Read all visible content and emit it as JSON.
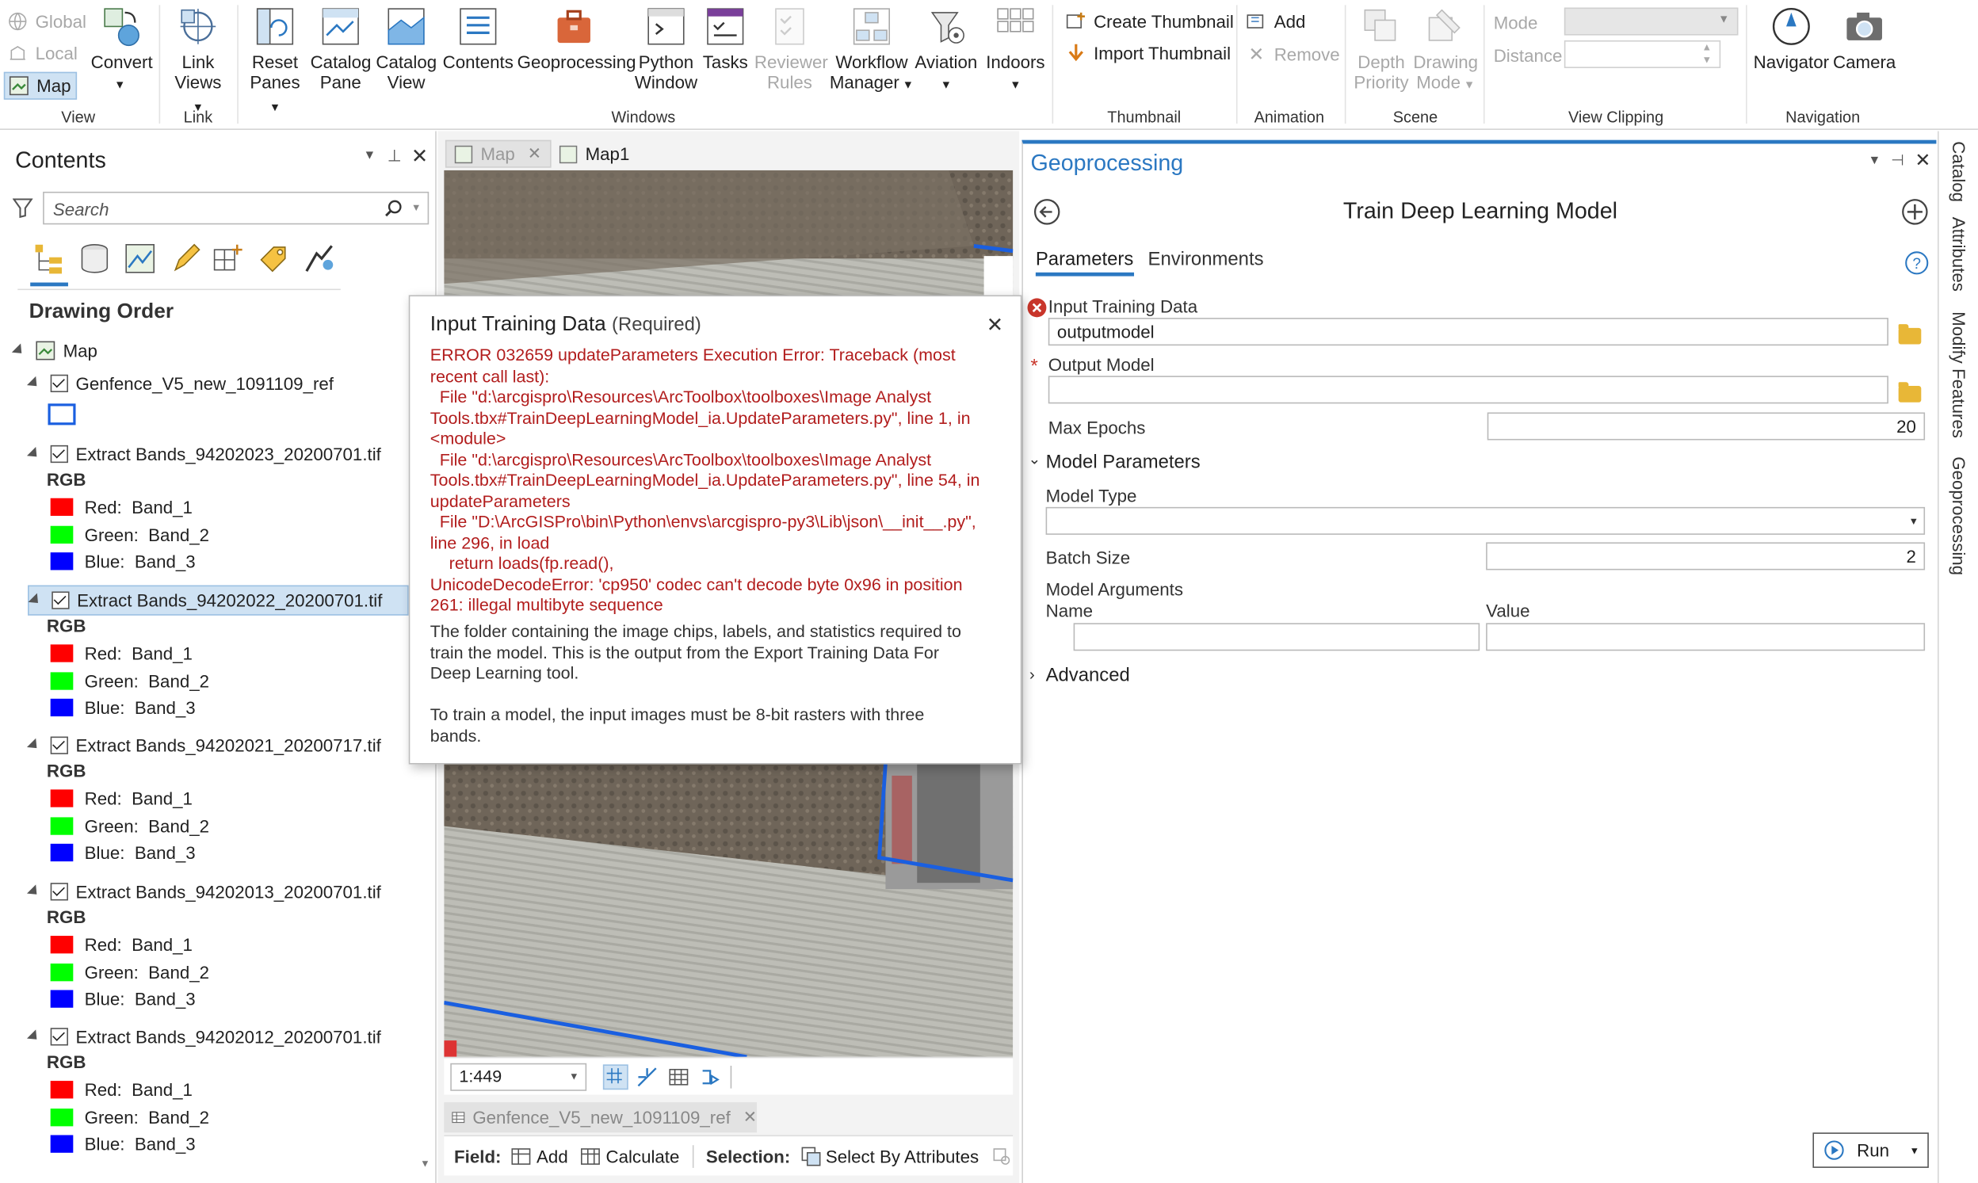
{
  "ribbon": {
    "view_group": {
      "label": "View",
      "global": "Global",
      "local": "Local",
      "map": "Map",
      "convert": "Convert"
    },
    "link_group": {
      "label": "Link",
      "link_views_1": "Link",
      "link_views_2": "Views"
    },
    "windows_group": {
      "label": "Windows",
      "items": [
        {
          "l1": "Reset",
          "l2": "Panes",
          "icon": "reset-panes-icon"
        },
        {
          "l1": "Catalog",
          "l2": "Pane",
          "icon": "catalog-pane-icon"
        },
        {
          "l1": "Catalog",
          "l2": "View",
          "icon": "catalog-view-icon"
        },
        {
          "l1": "Contents",
          "l2": "",
          "icon": "contents-icon"
        },
        {
          "l1": "Geoprocessing",
          "l2": "",
          "icon": "toolbox-icon"
        },
        {
          "l1": "Python",
          "l2": "Window",
          "icon": "python-window-icon"
        },
        {
          "l1": "Tasks",
          "l2": "",
          "icon": "tasks-icon"
        },
        {
          "l1": "Reviewer",
          "l2": "Rules",
          "icon": "reviewer-rules-icon"
        },
        {
          "l1": "Workflow",
          "l2": "Manager",
          "icon": "workflow-manager-icon"
        },
        {
          "l1": "Aviation",
          "l2": "",
          "icon": "aviation-icon"
        },
        {
          "l1": "Indoors",
          "l2": "",
          "icon": "indoors-icon"
        }
      ]
    },
    "thumbnail_group": {
      "label": "Thumbnail",
      "create": "Create Thumbnail",
      "import": "Import Thumbnail"
    },
    "animation_group": {
      "label": "Animation",
      "add": "Add",
      "remove": "Remove"
    },
    "scene_group": {
      "label": "Scene",
      "depth_1": "Depth",
      "depth_2": "Priority",
      "drawing_1": "Drawing",
      "drawing_2": "Mode"
    },
    "clipping_group": {
      "label": "View Clipping",
      "mode": "Mode",
      "distance": "Distance"
    },
    "navigation_group": {
      "label": "Navigation",
      "navigator": "Navigator",
      "camera": "Camera"
    }
  },
  "contents": {
    "title": "Contents",
    "search_placeholder": "Search",
    "drawing_order": "Drawing Order",
    "map_label": "Map",
    "ref_layer": "Genfence_V5_new_1091109_ref",
    "layers": [
      {
        "name": "Extract Bands_94202023_20200701.tif",
        "selected": false
      },
      {
        "name": "Extract Bands_94202022_20200701.tif",
        "selected": true
      },
      {
        "name": "Extract Bands_94202021_20200717.tif",
        "selected": false
      },
      {
        "name": "Extract Bands_94202013_20200701.tif",
        "selected": false
      },
      {
        "name": "Extract Bands_94202012_20200701.tif",
        "selected": false
      }
    ],
    "rgb": "RGB",
    "bands": [
      {
        "label": "Red:",
        "value": "Band_1",
        "color": "#ff0000"
      },
      {
        "label": "Green:",
        "value": "Band_2",
        "color": "#00ff00"
      },
      {
        "label": "Blue:",
        "value": "Band_3",
        "color": "#0000ff"
      }
    ]
  },
  "map_view": {
    "tabs": [
      {
        "label": "Map"
      },
      {
        "label": "Map1"
      }
    ],
    "scale": "1:449",
    "table_tab": "Genfence_V5_new_1091109_ref",
    "field_label": "Field:",
    "add": "Add",
    "calculate": "Calculate",
    "selection_label": "Selection:",
    "select_by_attributes": "Select By Attributes"
  },
  "popup": {
    "title": "Input Training Data",
    "required": "(Required)",
    "error_lines": [
      "ERROR 032659 updateParameters Execution Error: Traceback (most",
      "recent call last):",
      "  File \"d:\\arcgispro\\Resources\\ArcToolbox\\toolboxes\\Image Analyst",
      "Tools.tbx#TrainDeepLearningModel_ia.UpdateParameters.py\", line 1, in",
      "<module>",
      "  File \"d:\\arcgispro\\Resources\\ArcToolbox\\toolboxes\\Image Analyst",
      "Tools.tbx#TrainDeepLearningModel_ia.UpdateParameters.py\", line 54, in",
      "updateParameters",
      "  File \"D:\\ArcGISPro\\bin\\Python\\envs\\arcgispro-py3\\Lib\\json\\__init__.py\",",
      "line 296, in load",
      "    return loads(fp.read(),",
      "UnicodeDecodeError: 'cp950' codec can't decode byte 0x96 in position",
      "261: illegal multibyte sequence"
    ],
    "desc1_lines": [
      "The folder containing the image chips, labels, and statistics required to",
      "train the model. This is the output from the Export Training Data For",
      "Deep Learning tool."
    ],
    "desc2_lines": [
      "To train a model, the input images must be 8-bit rasters with three",
      "bands."
    ]
  },
  "geoprocessing": {
    "title": "Geoprocessing",
    "tool_title": "Train Deep Learning Model",
    "tab_parameters": "Parameters",
    "tab_environments": "Environments",
    "input_label": "Input Training Data",
    "input_value": "outputmodel",
    "output_label": "Output Model",
    "output_value": "",
    "max_epochs_label": "Max Epochs",
    "max_epochs_value": "20",
    "model_params": "Model Parameters",
    "model_type_label": "Model Type",
    "model_type_value": "",
    "batch_size_label": "Batch Size",
    "batch_size_value": "2",
    "model_args_label": "Model Arguments",
    "name_col": "Name",
    "value_col": "Value",
    "advanced": "Advanced",
    "run": "Run"
  },
  "side_tabs": [
    "Catalog",
    "Attributes",
    "Modify Features",
    "Geoprocessing"
  ]
}
